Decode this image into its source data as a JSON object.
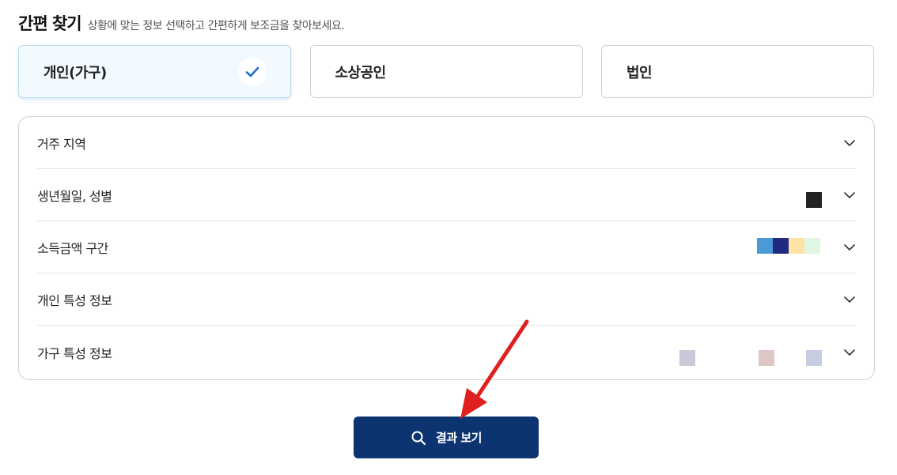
{
  "header": {
    "title": "간편 찾기",
    "subtitle": "상황에 맞는 정보 선택하고 간편하게 보조금을 찾아보세요."
  },
  "types": [
    {
      "label": "개인(가구)",
      "selected": true
    },
    {
      "label": "소상공인",
      "selected": false
    },
    {
      "label": "법인",
      "selected": false
    }
  ],
  "filters": [
    {
      "label": "거주 지역",
      "icon": "chevron-down-icon"
    },
    {
      "label": "생년월일, 성별",
      "icon": "chevron-down-icon",
      "swatch_colors": [
        "#222222"
      ]
    },
    {
      "label": "소득금액 구간",
      "icon": "chevron-down-icon",
      "swatch_colors": [
        "#4a9ad8",
        "#1f2a80",
        "#fde3a4",
        "#e0f7e4"
      ]
    },
    {
      "label": "개인 특성 정보",
      "icon": "chevron-down-icon"
    },
    {
      "label": "가구 특성 정보",
      "icon": "chevron-down-icon",
      "swatch_colors": [
        "#c8c8d8",
        "#dcc6c6",
        "#c8cce0"
      ]
    }
  ],
  "search_button": {
    "label": "결과 보기",
    "icon": "search-icon"
  },
  "colors": {
    "accent": "#0b3470",
    "check": "#1e6fd4",
    "selected_bg": "#f2f9ff",
    "annotation_arrow": "#e02020"
  }
}
